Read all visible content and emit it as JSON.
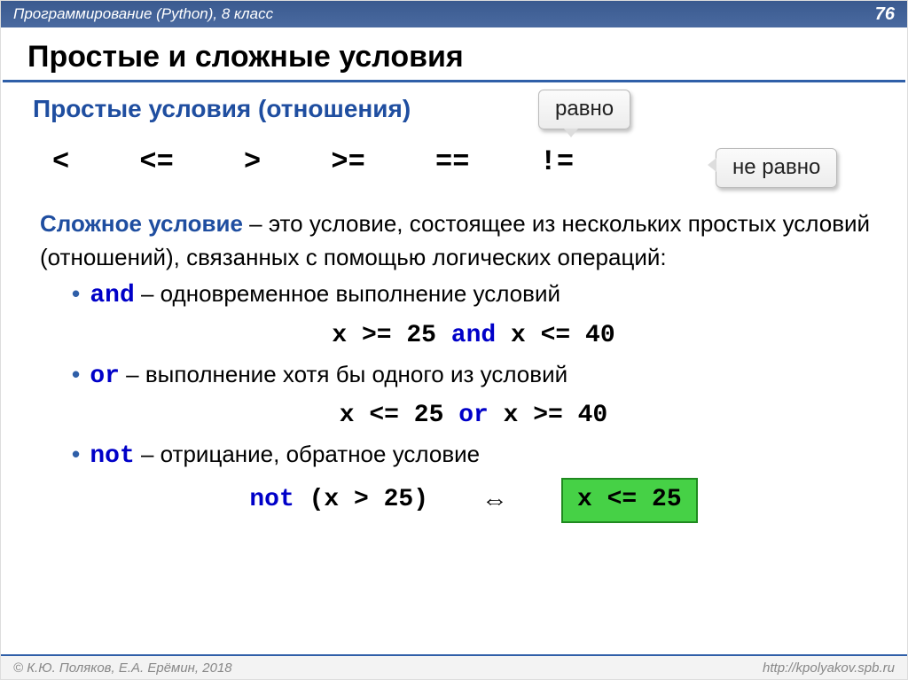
{
  "header": {
    "left": "Программирование (Python), 8 класс",
    "page": "76"
  },
  "title": "Простые и сложные условия",
  "sub1": "Простые условия (отношения)",
  "callout_eq": "равно",
  "callout_neq": "не равно",
  "operators_row": "< <= > >= == !=",
  "complex": {
    "lead_bold": "Сложное условие",
    "lead_rest": " – это условие, состоящее из нескольких простых условий (отношений), связанных с помощью логических операций:",
    "and_kw": "and",
    "and_text": " – одновременное выполнение условий",
    "and_code_pre": "x >= 25 ",
    "and_code_kw": "and",
    "and_code_post": " x <= 40",
    "or_kw": "or",
    "or_text": " – выполнение хотя бы одного из условий",
    "or_code_pre": "x <= 25 ",
    "or_code_kw": "or",
    "or_code_post": " x >= 40",
    "not_kw": "not",
    "not_text": " – отрицание, обратное условие",
    "not_code_kw": "not",
    "not_code_post": " (x > 25)",
    "equiv_sym": "⇔",
    "equiv_box": "x <= 25"
  },
  "footer": {
    "left": "© К.Ю. Поляков, Е.А. Ерёмин, 2018",
    "right": "http://kpolyakov.spb.ru"
  }
}
